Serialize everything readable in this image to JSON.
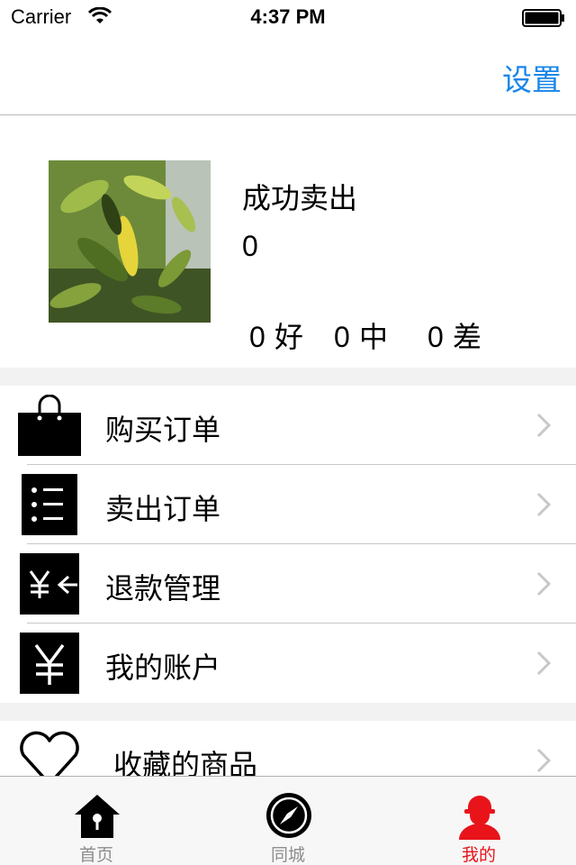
{
  "status_bar": {
    "carrier": "Carrier",
    "time": "4:37 PM"
  },
  "nav": {
    "settings_label": "设置"
  },
  "profile": {
    "sold_label": "成功卖出",
    "sold_count": "0",
    "ratings": {
      "good_count": "0",
      "good_label": "好",
      "neutral_count": "0",
      "neutral_label": "中",
      "bad_count": "0",
      "bad_label": "差"
    }
  },
  "menu": {
    "items": [
      {
        "label": "购买订单",
        "icon": "shopping-bag-icon"
      },
      {
        "label": "卖出订单",
        "icon": "list-icon"
      },
      {
        "label": "退款管理",
        "icon": "refund-icon"
      },
      {
        "label": "我的账户",
        "icon": "yen-icon"
      }
    ],
    "favorites": {
      "label": "收藏的商品",
      "icon": "heart-icon"
    }
  },
  "tabbar": {
    "tabs": [
      {
        "label": "首页",
        "icon": "home-icon"
      },
      {
        "label": "同城",
        "icon": "compass-icon"
      },
      {
        "label": "我的",
        "icon": "user-icon"
      }
    ],
    "active_color": "#e8141a",
    "inactive_color": "#8e8e8e"
  },
  "colors": {
    "accent": "#1a86e8",
    "separator": "#c8c8c8"
  }
}
